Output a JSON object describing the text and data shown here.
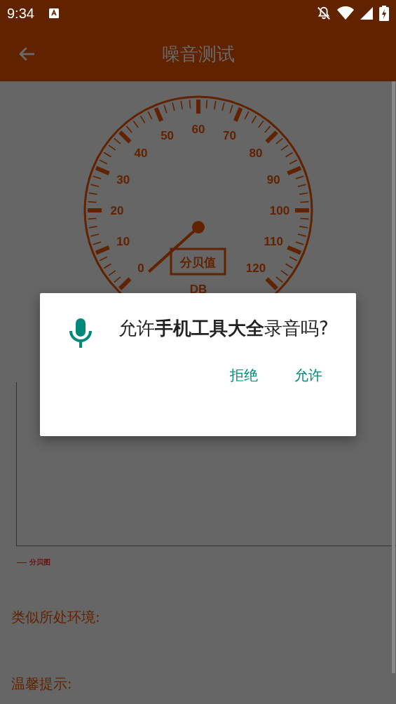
{
  "status_bar": {
    "time": "9:34"
  },
  "app_bar": {
    "title": "噪音测试"
  },
  "gauge": {
    "tick_labels": [
      "0",
      "10",
      "20",
      "30",
      "40",
      "50",
      "60",
      "70",
      "80",
      "90",
      "100",
      "110",
      "120"
    ],
    "value_label": "分贝值",
    "unit": "DB"
  },
  "chart": {
    "legend": "分贝图"
  },
  "environment_label": "类似所处环境:",
  "tips_label": "温馨提示:",
  "dialog": {
    "message": "允许**手机工具大全**录音吗?",
    "buttons": [
      {
        "label": "拒绝"
      },
      {
        "label": "允许"
      }
    ]
  }
}
